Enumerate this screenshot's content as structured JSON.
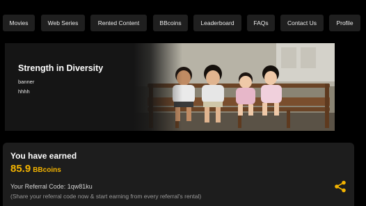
{
  "nav": {
    "items": [
      {
        "label": "Movies"
      },
      {
        "label": "Web Series"
      },
      {
        "label": "Rented Content"
      },
      {
        "label": "BBcoins"
      },
      {
        "label": "Leaderboard"
      },
      {
        "label": "FAQs"
      },
      {
        "label": "Contact Us"
      },
      {
        "label": "Profile"
      }
    ]
  },
  "banner": {
    "title": "Strength in Diversity",
    "subtitle": "banner",
    "description": "hhhh"
  },
  "earnings": {
    "heading": "You have earned",
    "amount": "85.9",
    "unit": "BBcoins",
    "referral_code": "Your Referral Code: 1qw81ku",
    "hint": "(Share your referral code now & start earning from every referral's rental)"
  },
  "colors": {
    "accent": "#f4b400",
    "background": "#000000",
    "card": "#1d1d1d",
    "nav_button": "#1f1f1f"
  },
  "icons": {
    "share": "share-icon"
  }
}
